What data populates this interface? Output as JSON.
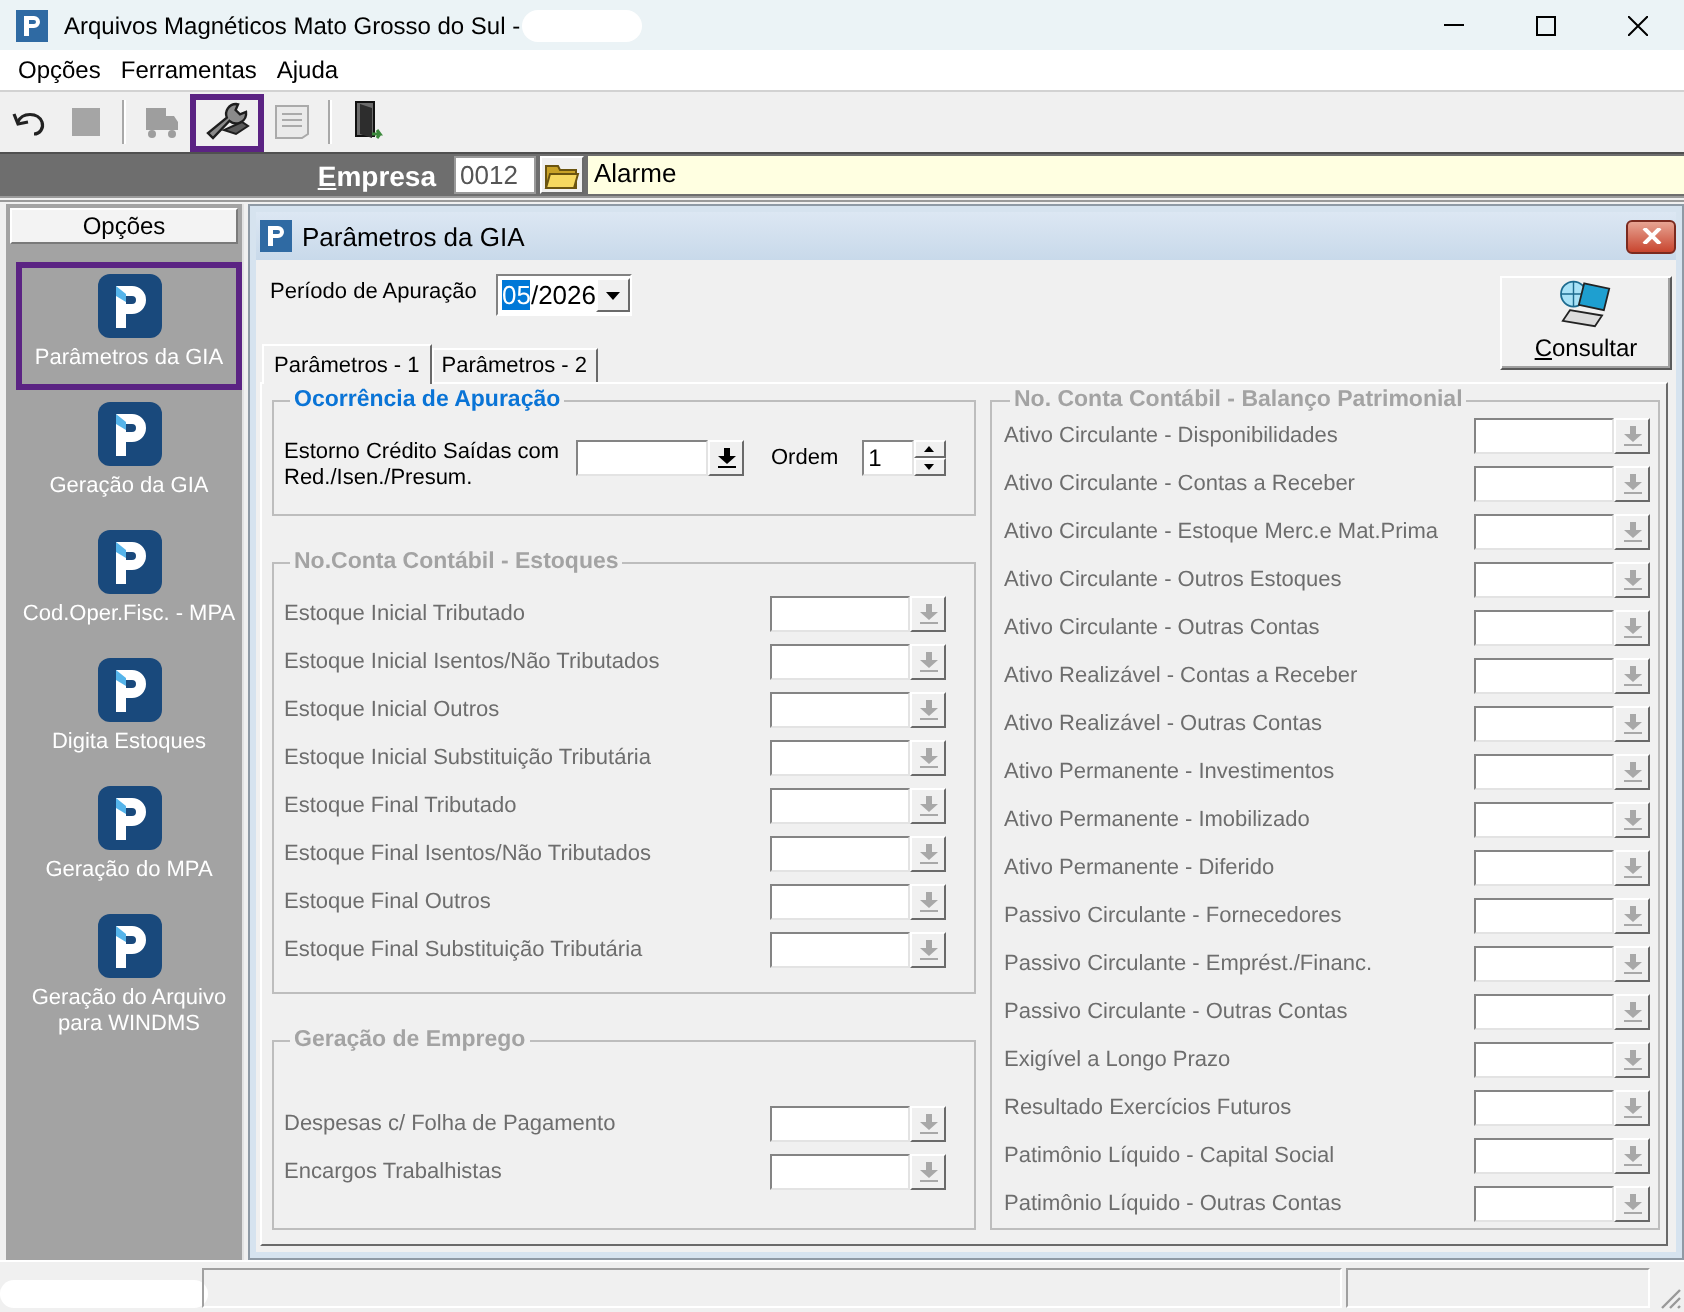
{
  "window": {
    "title": "Arquivos Magnéticos Mato Grosso do Sul -",
    "title_redacted": true
  },
  "menu": [
    {
      "label": "Opções"
    },
    {
      "label": "Ferramentas"
    },
    {
      "label": "Ajuda"
    }
  ],
  "toolbar": [
    {
      "kind": "button",
      "disabled": false,
      "highlighted": false
    },
    {
      "kind": "button",
      "disabled": true,
      "highlighted": false
    },
    {
      "kind": "separator"
    },
    {
      "kind": "button",
      "disabled": true,
      "highlighted": false
    },
    {
      "kind": "button",
      "disabled": false,
      "highlighted": true
    },
    {
      "kind": "button",
      "disabled": true,
      "highlighted": false
    },
    {
      "kind": "separator"
    },
    {
      "kind": "button",
      "disabled": false,
      "highlighted": false
    }
  ],
  "company_bar": {
    "label": "Empresa",
    "code": "0012",
    "name": "Alarme"
  },
  "sidebar": {
    "header": "Opções",
    "items": [
      {
        "label": "Parâmetros da GIA",
        "highlighted": true
      },
      {
        "label": "Geração da GIA",
        "highlighted": false
      },
      {
        "label": "Cod.Oper.Fisc. - MPA",
        "highlighted": false
      },
      {
        "label": "Digita Estoques",
        "highlighted": false
      },
      {
        "label": "Geração do MPA",
        "highlighted": false
      },
      {
        "label": "Geração do Arquivo para WINDMS",
        "highlighted": false
      }
    ]
  },
  "dialog": {
    "title": "Parâmetros da GIA",
    "period": {
      "label": "Período de Apuração",
      "value_selected": "05",
      "value_rest": "/2026"
    },
    "consult_button": "Consultar",
    "tabs": [
      {
        "label": "Parâmetros - 1",
        "selected": true
      },
      {
        "label": "Parâmetros - 2",
        "selected": false
      }
    ],
    "left_groups": [
      {
        "kind": "occurrence",
        "title": "Ocorrência de Apuração",
        "disabled": false,
        "field_label": "Estorno Crédito Saídas com Red./Isen./Presum.",
        "order_label": "Ordem",
        "order_value": "1"
      },
      {
        "kind": "accounts",
        "title": "No.Conta Contábil - Estoques",
        "disabled": true,
        "rows": [
          {
            "label": "Estoque Inicial Tributado"
          },
          {
            "label": "Estoque Inicial Isentos/Não Tributados"
          },
          {
            "label": "Estoque Inicial Outros"
          },
          {
            "label": "Estoque Inicial Substituição Tributária"
          },
          {
            "label": "Estoque Final Tributado"
          },
          {
            "label": "Estoque Final Isentos/Não Tributados"
          },
          {
            "label": "Estoque Final Outros"
          },
          {
            "label": "Estoque Final Substituição Tributária"
          }
        ]
      },
      {
        "kind": "accounts",
        "title": "Geração de Emprego",
        "disabled": true,
        "rows": [
          {
            "label": "Despesas c/ Folha de Pagamento"
          },
          {
            "label": "Encargos Trabalhistas"
          }
        ]
      }
    ],
    "right_group": {
      "title": "No. Conta Contábil - Balanço Patrimonial",
      "disabled": true,
      "rows": [
        {
          "label": "Ativo Circulante - Disponibilidades"
        },
        {
          "label": "Ativo Circulante - Contas a Receber"
        },
        {
          "label": "Ativo Circulante - Estoque Merc.e Mat.Prima"
        },
        {
          "label": "Ativo Circulante - Outros Estoques"
        },
        {
          "label": "Ativo Circulante - Outras Contas"
        },
        {
          "label": "Ativo Realizável - Contas a Receber"
        },
        {
          "label": "Ativo Realizável - Outras Contas"
        },
        {
          "label": "Ativo Permanente - Investimentos"
        },
        {
          "label": "Ativo Permanente - Imobilizado"
        },
        {
          "label": "Ativo Permanente - Diferido"
        },
        {
          "label": "Passivo Circulante - Fornecedores"
        },
        {
          "label": "Passivo Circulante - Emprést./Financ."
        },
        {
          "label": "Passivo Circulante - Outras Contas"
        },
        {
          "label": "Exigível a Longo Prazo"
        },
        {
          "label": "Resultado Exercícios Futuros"
        },
        {
          "label": "Patimônio Líquido - Capital Social"
        },
        {
          "label": "Patimônio Líquido - Outras Contas"
        }
      ]
    }
  },
  "status_bar": {
    "redacted": true
  }
}
